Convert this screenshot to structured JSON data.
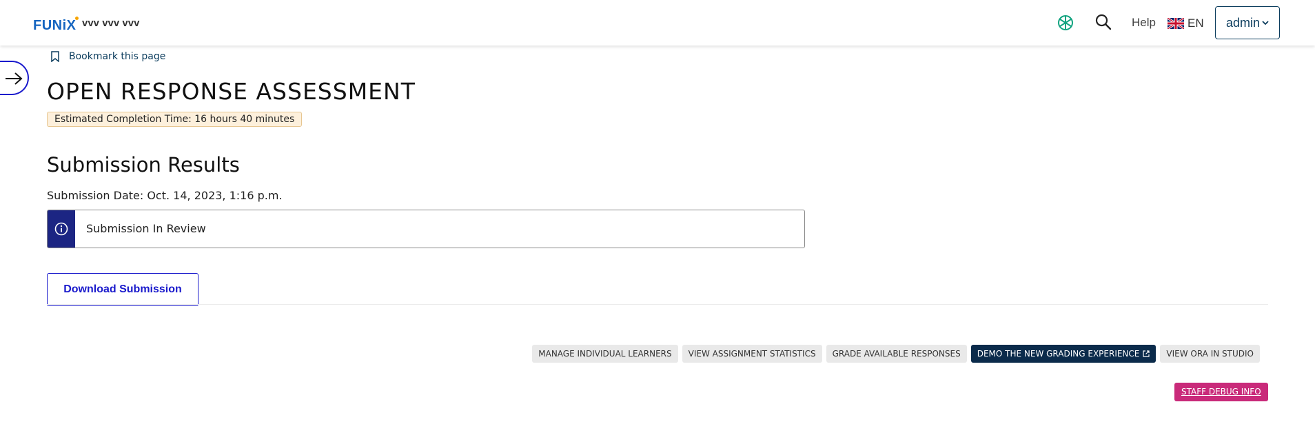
{
  "header": {
    "logo_text": "FUNiX",
    "course_title": "vvv vvv  vvv",
    "help_label": "Help",
    "language_code": "EN",
    "user_label": "admin",
    "icons": [
      "openai-icon",
      "search-icon",
      "uk-flag-icon",
      "chevron-down-icon"
    ]
  },
  "page": {
    "bookmark_label": "Bookmark this page",
    "unit_title": "OPEN RESPONSE ASSESSMENT",
    "estimated_time": "Estimated Completion Time: 16 hours 40 minutes"
  },
  "submission": {
    "heading": "Submission Results",
    "date_text": "Submission Date: Oct. 14, 2023, 1:16 p.m.",
    "status_text": "Submission In Review",
    "download_label": "Download Submission"
  },
  "staff_tools": {
    "buttons": [
      "MANAGE INDIVIDUAL LEARNERS",
      "VIEW ASSIGNMENT STATISTICS",
      "GRADE AVAILABLE RESPONSES",
      "DEMO THE NEW GRADING EXPERIENCE",
      "VIEW ORA IN STUDIO"
    ],
    "debug_label": "STAFF DEBUG INFO"
  },
  "colors": {
    "brand_blue": "#1565c0",
    "primary_link": "#1a1acc",
    "navy": "#0b2b4b",
    "info_bar": "#1c2583",
    "debug_pink": "#c92a7a",
    "badge_bg": "#fdf0dc"
  }
}
